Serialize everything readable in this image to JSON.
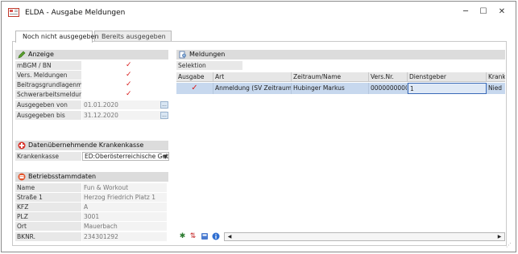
{
  "window": {
    "title": "ELDA - Ausgabe Meldungen",
    "minimize": "─",
    "maximize": "☐",
    "close": "✕"
  },
  "tabs": [
    {
      "label": "Noch nicht ausgegeben",
      "active": true
    },
    {
      "label": "Bereits ausgegeben",
      "active": false
    }
  ],
  "anzeige": {
    "header": "Anzeige",
    "rows": [
      {
        "label": "mBGM / BN",
        "checked": true
      },
      {
        "label": "Vers. Meldungen",
        "checked": true
      },
      {
        "label": "Beitragsgrundlagenmeld",
        "checked": true
      },
      {
        "label": "Schwerarbeitsmeldung",
        "checked": true
      }
    ],
    "von_label": "Ausgegeben von",
    "von_value": "01.01.2020",
    "bis_label": "Ausgegeben bis",
    "bis_value": "31.12.2020",
    "date_button": "..."
  },
  "krankenkasse": {
    "header": "Datenübernehmende Krankenkasse",
    "label": "Krankenkasse",
    "value": "ED:Oberösterreichische Geb"
  },
  "betrieb": {
    "header": "Betriebsstammdaten",
    "rows": [
      {
        "label": "Name",
        "value": "Fun & Workout"
      },
      {
        "label": "Straße 1",
        "value": "Herzog Friedrich Platz 1"
      },
      {
        "label": "KFZ",
        "value": "A"
      },
      {
        "label": "PLZ",
        "value": "3001"
      },
      {
        "label": "Ort",
        "value": "Mauerbach"
      },
      {
        "label": "BKNR.",
        "value": "234301292"
      }
    ]
  },
  "meldungen": {
    "header": "Meldungen",
    "selektion_label": "Selektion",
    "columns": [
      "Ausgabe",
      "Art",
      "Zeitraum/Name",
      "Vers.Nr.",
      "Dienstgeber",
      "Krank"
    ],
    "rows": [
      {
        "ausgabe": "✓",
        "art": "Anmeldung (SV Zeitraum ...",
        "name": "Hubinger Markus",
        "versnr": "0000000000",
        "dienstgeber": "1",
        "krank": "Nied"
      }
    ]
  },
  "scroll": {
    "left": "◀",
    "right": "▶"
  },
  "colors": {
    "accent_check": "#d81c1c",
    "selected_row": "#c7d8ee",
    "header_bg": "#dcdcdc"
  }
}
